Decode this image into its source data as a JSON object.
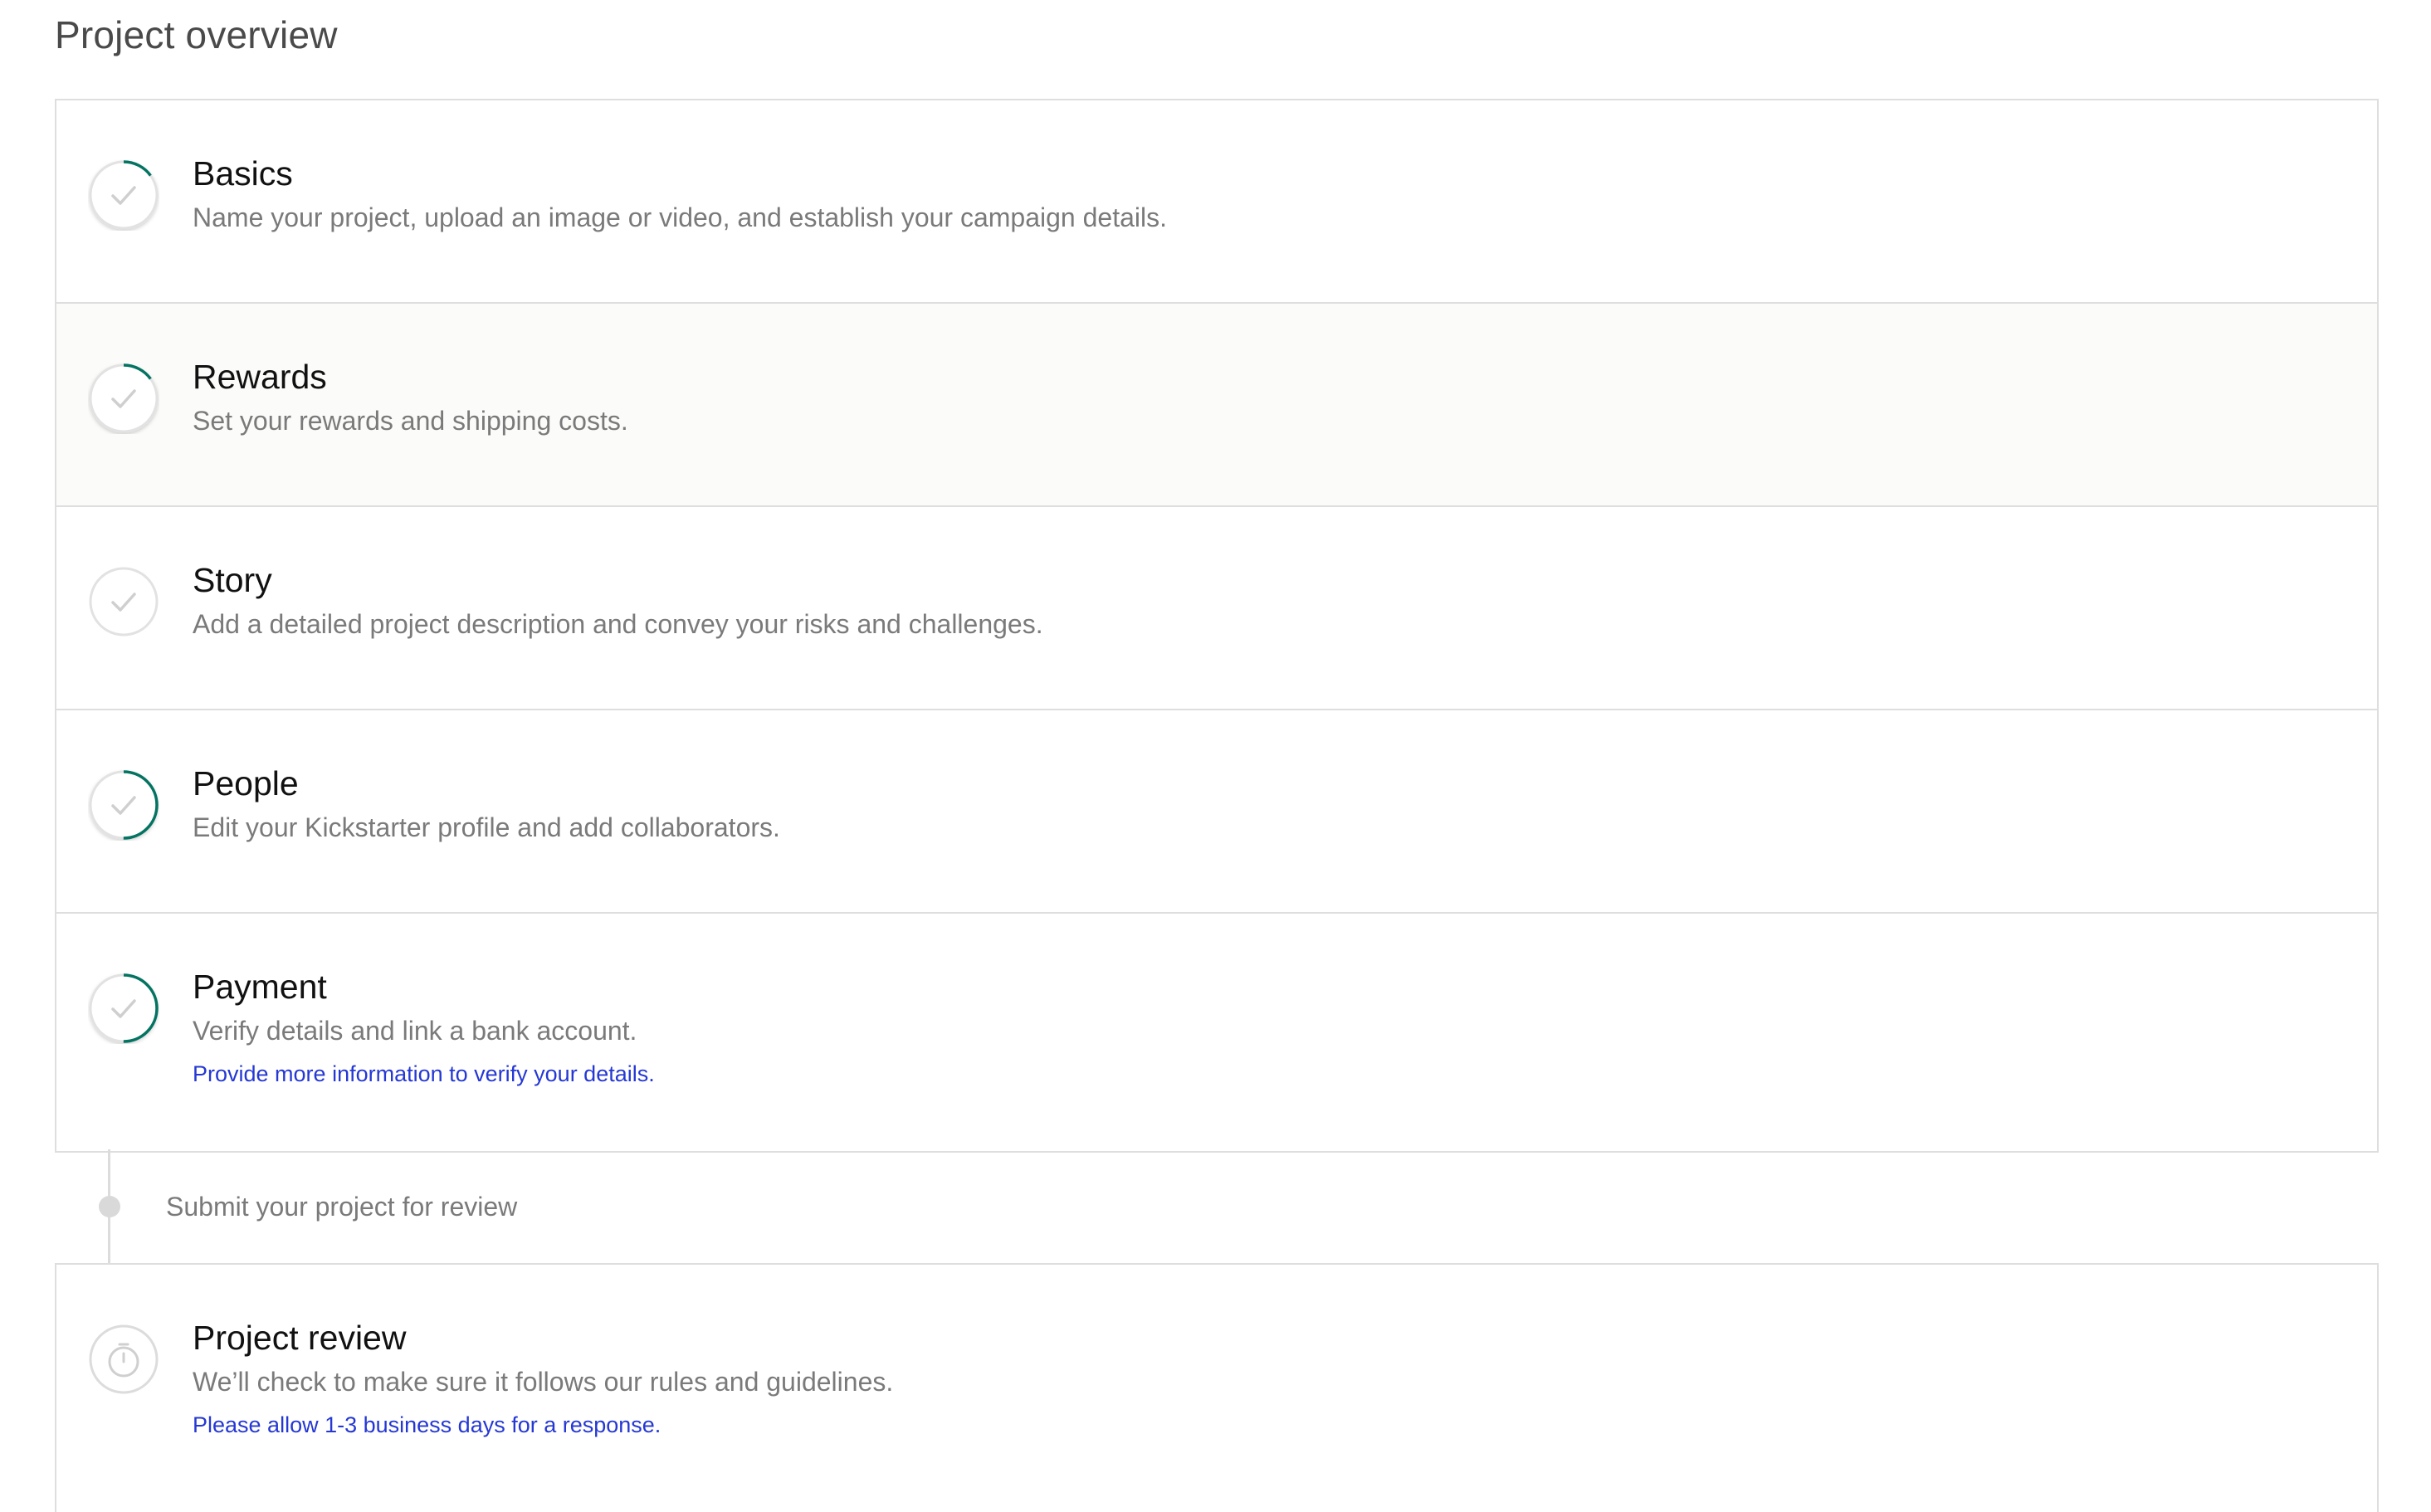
{
  "page": {
    "title": "Project overview"
  },
  "steps": [
    {
      "title": "Basics",
      "description": "Name your project, upload an image or video, and establish your campaign details.",
      "icon": "check-circle-icon",
      "progress": 0.15
    },
    {
      "title": "Rewards",
      "description": "Set your rewards and shipping costs.",
      "icon": "check-circle-icon",
      "progress": 0.15,
      "hovered": true
    },
    {
      "title": "Story",
      "description": "Add a detailed project description and convey your risks and challenges.",
      "icon": "check-circle-icon",
      "progress": 0
    },
    {
      "title": "People",
      "description": "Edit your Kickstarter profile and add collaborators.",
      "icon": "check-circle-icon",
      "progress": 0.5
    },
    {
      "title": "Payment",
      "description": "Verify details and link a bank account.",
      "link": "Provide more information to verify your details.",
      "icon": "check-circle-icon",
      "progress": 0.5
    }
  ],
  "submit": {
    "label": "Submit your project for review"
  },
  "review": {
    "title": "Project review",
    "description": "We’ll check to make sure it follows our rules and guidelines.",
    "note": "Please allow 1-3 business days for a response.",
    "icon": "stopwatch-icon"
  },
  "colors": {
    "progress_accent": "#037362",
    "link": "#2538d4",
    "border": "#dedede"
  }
}
